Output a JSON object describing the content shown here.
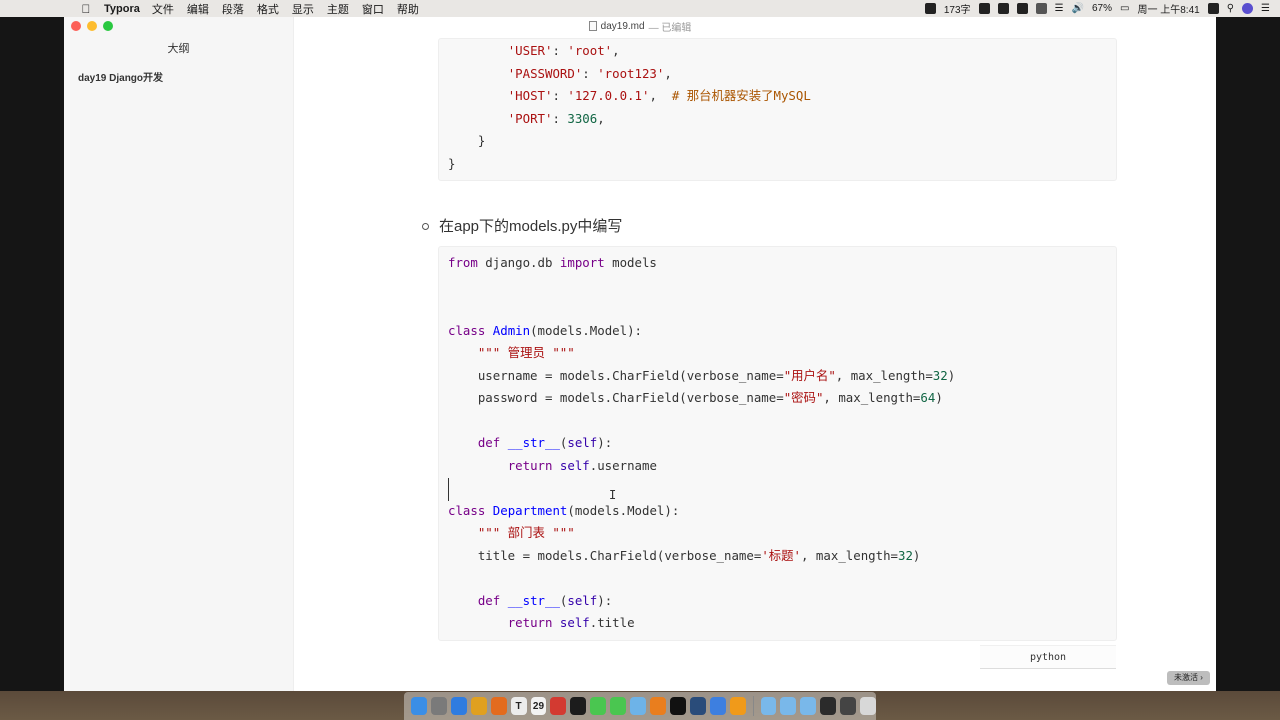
{
  "menubar": {
    "app_name": "Typora",
    "items": [
      "文件",
      "编辑",
      "段落",
      "格式",
      "显示",
      "主题",
      "窗口",
      "帮助"
    ],
    "status": {
      "word_count": "173字",
      "battery": "67%",
      "clock": "周一 上午8:41"
    }
  },
  "window": {
    "title": "day19.md",
    "edited_label": "— 已编辑"
  },
  "sidebar": {
    "outline_title": "大纲",
    "items": [
      {
        "label": "day19 Django开发"
      }
    ]
  },
  "document": {
    "list_item": "在app下的models.py中编写",
    "code_block_lang": "python"
  },
  "code_top_lines": [
    [
      {
        "t": "        "
      },
      {
        "t": "'USER'",
        "c": "str"
      },
      {
        "t": ": "
      },
      {
        "t": "'root'",
        "c": "str"
      },
      {
        "t": ","
      }
    ],
    [
      {
        "t": "        "
      },
      {
        "t": "'PASSWORD'",
        "c": "str"
      },
      {
        "t": ": "
      },
      {
        "t": "'root123'",
        "c": "str"
      },
      {
        "t": ","
      }
    ],
    [
      {
        "t": "        "
      },
      {
        "t": "'HOST'",
        "c": "str"
      },
      {
        "t": ": "
      },
      {
        "t": "'127.0.0.1'",
        "c": "str"
      },
      {
        "t": ",  "
      },
      {
        "t": "# 那台机器安装了MySQL",
        "c": "cm"
      }
    ],
    [
      {
        "t": "        "
      },
      {
        "t": "'PORT'",
        "c": "str"
      },
      {
        "t": ": "
      },
      {
        "t": "3306",
        "c": "num"
      },
      {
        "t": ","
      }
    ],
    [
      {
        "t": "    }"
      }
    ],
    [
      {
        "t": "}"
      }
    ]
  ],
  "code_main_lines": [
    [
      {
        "t": "from",
        "c": "kw"
      },
      {
        "t": " django.db "
      },
      {
        "t": "import",
        "c": "kw"
      },
      {
        "t": " models"
      }
    ],
    [],
    [],
    [
      {
        "t": "class",
        "c": "kw"
      },
      {
        "t": " "
      },
      {
        "t": "Admin",
        "c": "def"
      },
      {
        "t": "(models.Model):"
      }
    ],
    [
      {
        "t": "    "
      },
      {
        "t": "\"\"\" 管理员 \"\"\"",
        "c": "str"
      }
    ],
    [
      {
        "t": "    username = models.CharField(verbose_name="
      },
      {
        "t": "\"用户名\"",
        "c": "str"
      },
      {
        "t": ", max_length="
      },
      {
        "t": "32",
        "c": "num"
      },
      {
        "t": ")"
      }
    ],
    [
      {
        "t": "    password = models.CharField(verbose_name="
      },
      {
        "t": "\"密码\"",
        "c": "str"
      },
      {
        "t": ", max_length="
      },
      {
        "t": "64",
        "c": "num"
      },
      {
        "t": ")"
      }
    ],
    [],
    [
      {
        "t": "    "
      },
      {
        "t": "def",
        "c": "kw"
      },
      {
        "t": " "
      },
      {
        "t": "__str__",
        "c": "def"
      },
      {
        "t": "("
      },
      {
        "t": "self",
        "c": "builtin"
      },
      {
        "t": "):"
      }
    ],
    [
      {
        "t": "        "
      },
      {
        "t": "return",
        "c": "kw"
      },
      {
        "t": " "
      },
      {
        "t": "self",
        "c": "builtin"
      },
      {
        "t": ".username"
      }
    ],
    [],
    [
      {
        "t": "class",
        "c": "kw"
      },
      {
        "t": " "
      },
      {
        "t": "Department",
        "c": "def"
      },
      {
        "t": "(models.Model):"
      }
    ],
    [
      {
        "t": "    "
      },
      {
        "t": "\"\"\" 部门表 \"\"\"",
        "c": "str"
      }
    ],
    [
      {
        "t": "    title = models.CharField(verbose_name="
      },
      {
        "t": "'标题'",
        "c": "str"
      },
      {
        "t": ", max_length="
      },
      {
        "t": "32",
        "c": "num"
      },
      {
        "t": ")"
      }
    ],
    [],
    [
      {
        "t": "    "
      },
      {
        "t": "def",
        "c": "kw"
      },
      {
        "t": " "
      },
      {
        "t": "__str__",
        "c": "def"
      },
      {
        "t": "("
      },
      {
        "t": "self",
        "c": "builtin"
      },
      {
        "t": "):"
      }
    ],
    [
      {
        "t": "        "
      },
      {
        "t": "return",
        "c": "kw"
      },
      {
        "t": " "
      },
      {
        "t": "self",
        "c": "builtin"
      },
      {
        "t": ".title"
      }
    ]
  ],
  "overlay": {
    "activate_badge": "未激活 ›"
  },
  "dock": {
    "icons": [
      {
        "name": "finder-icon",
        "color": "#3a8ee6",
        "glyph": ""
      },
      {
        "name": "launchpad-icon",
        "color": "#7a7a7a",
        "glyph": ""
      },
      {
        "name": "safari-icon",
        "color": "#2f7ce0",
        "glyph": ""
      },
      {
        "name": "chrome-icon",
        "color": "#e0a020",
        "glyph": ""
      },
      {
        "name": "firefox-icon",
        "color": "#e36b1e",
        "glyph": ""
      },
      {
        "name": "typora-icon",
        "color": "#ececec",
        "glyph": "T"
      },
      {
        "name": "calendar-icon",
        "color": "#f2f2f2",
        "glyph": "29"
      },
      {
        "name": "netease-music-icon",
        "color": "#d33a31",
        "glyph": ""
      },
      {
        "name": "pycharm-icon",
        "color": "#1c1c1c",
        "glyph": ""
      },
      {
        "name": "wechat-icon",
        "color": "#4ac650",
        "glyph": ""
      },
      {
        "name": "messages-icon",
        "color": "#4ac650",
        "glyph": ""
      },
      {
        "name": "preview-icon",
        "color": "#6db3e8",
        "glyph": ""
      },
      {
        "name": "sublime-icon",
        "color": "#e97e1e",
        "glyph": ""
      },
      {
        "name": "terminal-icon",
        "color": "#111111",
        "glyph": ""
      },
      {
        "name": "quicktime-icon",
        "color": "#2a4c7a",
        "glyph": ""
      },
      {
        "name": "feishu-icon",
        "color": "#3d7fe0",
        "glyph": ""
      },
      {
        "name": "app-orange-icon",
        "color": "#f09a1a",
        "glyph": ""
      },
      {
        "name": "sep",
        "color": "",
        "glyph": ""
      },
      {
        "name": "downloads-folder-icon",
        "color": "#79b8ea",
        "glyph": ""
      },
      {
        "name": "folder-icon",
        "color": "#79b8ea",
        "glyph": ""
      },
      {
        "name": "folder-icon",
        "color": "#79b8ea",
        "glyph": ""
      },
      {
        "name": "screen-thumbnail-icon",
        "color": "#2b2b2b",
        "glyph": ""
      },
      {
        "name": "screen-thumbnail-icon",
        "color": "#444444",
        "glyph": ""
      },
      {
        "name": "trash-icon",
        "color": "#d8d8d8",
        "glyph": ""
      }
    ]
  }
}
